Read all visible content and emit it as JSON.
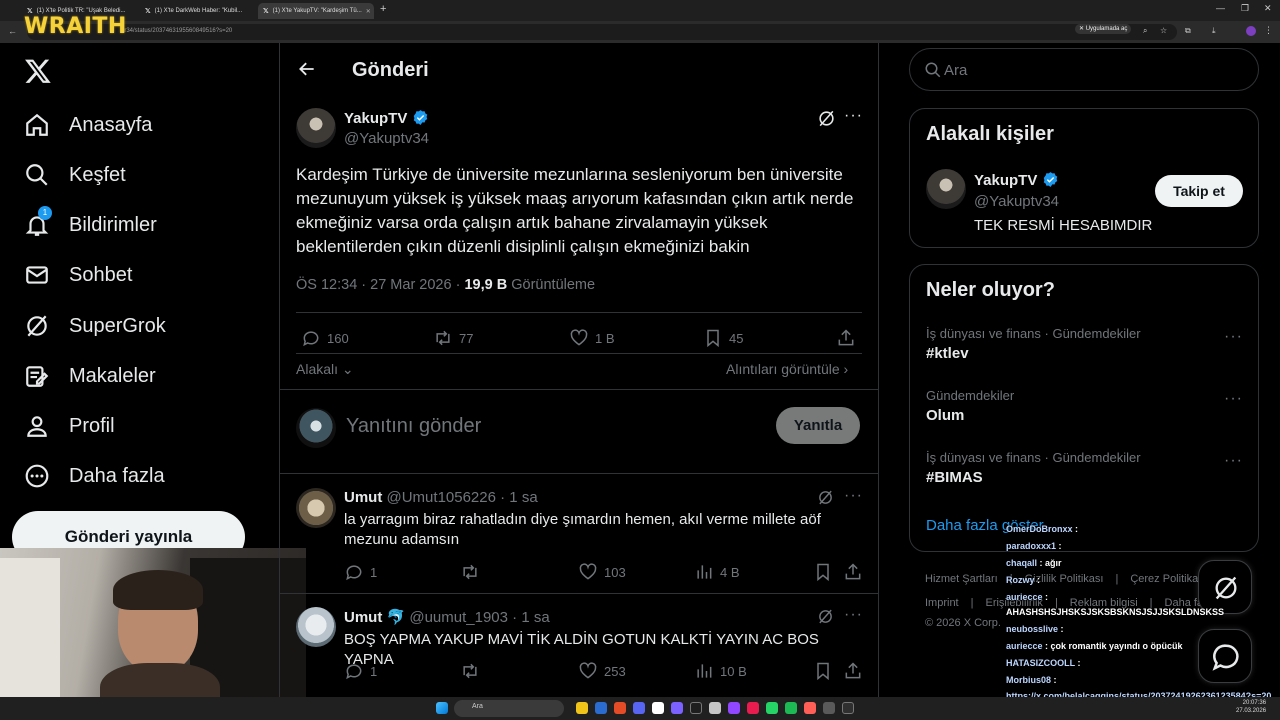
{
  "browser": {
    "tabs": [
      {
        "title": "(1) X'te Politik TR: \"Uşak Beledi...",
        "active": false
      },
      {
        "title": "(1) X'te DarkWeb Haber: \"Kubil...",
        "active": false
      },
      {
        "title": "(1) X'te YakupTV: \"Kardeşim Tü...",
        "active": true
      }
    ],
    "url": "ar34/status/2037463195560849516?s=20",
    "open_in_app": "Uygulamada aç"
  },
  "overlay_logo": "WRAITH",
  "nav": {
    "items": [
      {
        "label": "Anasayfa",
        "icon": "home-icon"
      },
      {
        "label": "Keşfet",
        "icon": "search-icon"
      },
      {
        "label": "Bildirimler",
        "icon": "bell-icon",
        "badge": "1"
      },
      {
        "label": "Sohbet",
        "icon": "mail-icon"
      },
      {
        "label": "SuperGrok",
        "icon": "grok-icon"
      },
      {
        "label": "Makaleler",
        "icon": "article-icon"
      },
      {
        "label": "Profil",
        "icon": "person-icon"
      },
      {
        "label": "Daha fazla",
        "icon": "more-icon"
      }
    ],
    "post_button": "Gönderi yayınla"
  },
  "header": {
    "title": "Gönderi"
  },
  "tweet": {
    "name": "YakupTV",
    "handle": "@Yakuptv34",
    "text": "Kardeşim Türkiye de üniversite mezunlarına sesleniyorum ben üniversite mezunuyum yüksek iş yüksek maaş arıyorum kafasından çıkın artık nerde ekmeğiniz varsa orda çalışın artık bahane zirvalamayin yüksek beklentilerden çıkın düzenli disiplinli çalışın ekmeğinizi bakin",
    "time": "ÖS 12:34 · 27 Mar 2026",
    "views": "19,9 B",
    "views_label": "Görüntüleme",
    "replies": "160",
    "reposts": "77",
    "likes": "1 B",
    "bookmarks": "45",
    "filter": "Alakalı",
    "quotes_link": "Alıntıları görüntüle"
  },
  "reply_box": {
    "placeholder": "Yanıtını gönder",
    "button": "Yanıtla"
  },
  "replies": [
    {
      "name": "Umut",
      "handle": "@Umut1056226",
      "time": "· 1 sa",
      "text": "la yarragım biraz rahatladın diye şımardın hemen, akıl verme millete aöf mezunu adamsın",
      "replies": "1",
      "likes": "103",
      "views": "4 B"
    },
    {
      "name": "Umut",
      "emoji": "🐬",
      "handle": "@uumut_1903",
      "time": "· 1 sa",
      "text": "BOŞ YAPMA YAKUP MAVİ TİK ALDİN GOTUN KALKTİ YAYIN AC BOS YAPNA",
      "replies": "1",
      "likes": "253",
      "views": "10 B"
    }
  ],
  "search": {
    "placeholder": "Ara"
  },
  "related": {
    "title": "Alakalı kişiler",
    "name": "YakupTV",
    "handle": "@Yakuptv34",
    "bio": "TEK RESMİ HESABIMDIR",
    "follow": "Takip et"
  },
  "trends": {
    "title": "Neler oluyor?",
    "items": [
      {
        "meta": "İş dünyası ve finans · Gündemdekiler",
        "name": "#ktlev"
      },
      {
        "meta": "Gündemdekiler",
        "name": "Olum"
      },
      {
        "meta": "İş dünyası ve finans · Gündemdekiler",
        "name": "#BIMAS"
      }
    ],
    "more": "Daha fazla göster"
  },
  "footer": {
    "row1": [
      "Hizmet Şartları",
      "Gizlilik Politikası",
      "Çerez Politikası"
    ],
    "row2": [
      "Imprint",
      "Erişilebilirlik",
      "Reklam bilgisi",
      "Daha fazla"
    ],
    "copyright": "© 2026 X Corp."
  },
  "chat": [
    {
      "user": "OmerDoBronxx",
      "msg": ""
    },
    {
      "user": "paradoxxx1",
      "msg": ""
    },
    {
      "user": "chaqall",
      "msg": "ağır"
    },
    {
      "user": "Rozwy",
      "msg": ""
    },
    {
      "user": "auriecce",
      "msg": ""
    },
    {
      "user": "",
      "msg": "AHASHSHSJHSKSJSKSBSKNSJSJJSKSLDNSKSS"
    },
    {
      "user": "neubosslive",
      "msg": ""
    },
    {
      "user": "auriecce",
      "msg": "çok romantik yayındı o öpücük"
    },
    {
      "user": "HATASIZCOOLL",
      "msg": ""
    },
    {
      "user": "Morbius08",
      "msg": ""
    },
    {
      "user": "",
      "msg": "https://x.com/belalcaggins/status/2037241926236123584?s=20"
    }
  ],
  "taskbar": {
    "search": "Ara",
    "time": "20:07:36",
    "date": "27.03.2026"
  }
}
